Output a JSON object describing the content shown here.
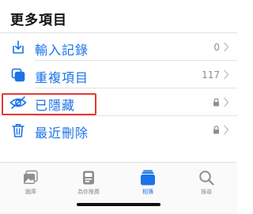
{
  "section": {
    "title": "更多項目"
  },
  "rows": [
    {
      "label": "輸入記錄",
      "count": "0",
      "icon": "import-icon",
      "locked": false
    },
    {
      "label": "重複項目",
      "count": "117",
      "icon": "duplicate-icon",
      "locked": false
    },
    {
      "label": "已隱藏",
      "count": "",
      "icon": "eye-icon",
      "locked": true,
      "highlighted": true
    },
    {
      "label": "最近刪除",
      "count": "",
      "icon": "trash-icon",
      "locked": true
    }
  ],
  "tabs": [
    {
      "label": "圖庫",
      "icon": "library-icon",
      "active": false
    },
    {
      "label": "為你推薦",
      "icon": "for-you-icon",
      "active": false
    },
    {
      "label": "相簿",
      "icon": "albums-icon",
      "active": true
    },
    {
      "label": "搜尋",
      "icon": "search-icon",
      "active": false
    }
  ],
  "colors": {
    "accent": "#1a73e8",
    "secondary_text": "#8e8e93",
    "highlight_border": "#e53935",
    "divider": "#e2e2e4"
  }
}
